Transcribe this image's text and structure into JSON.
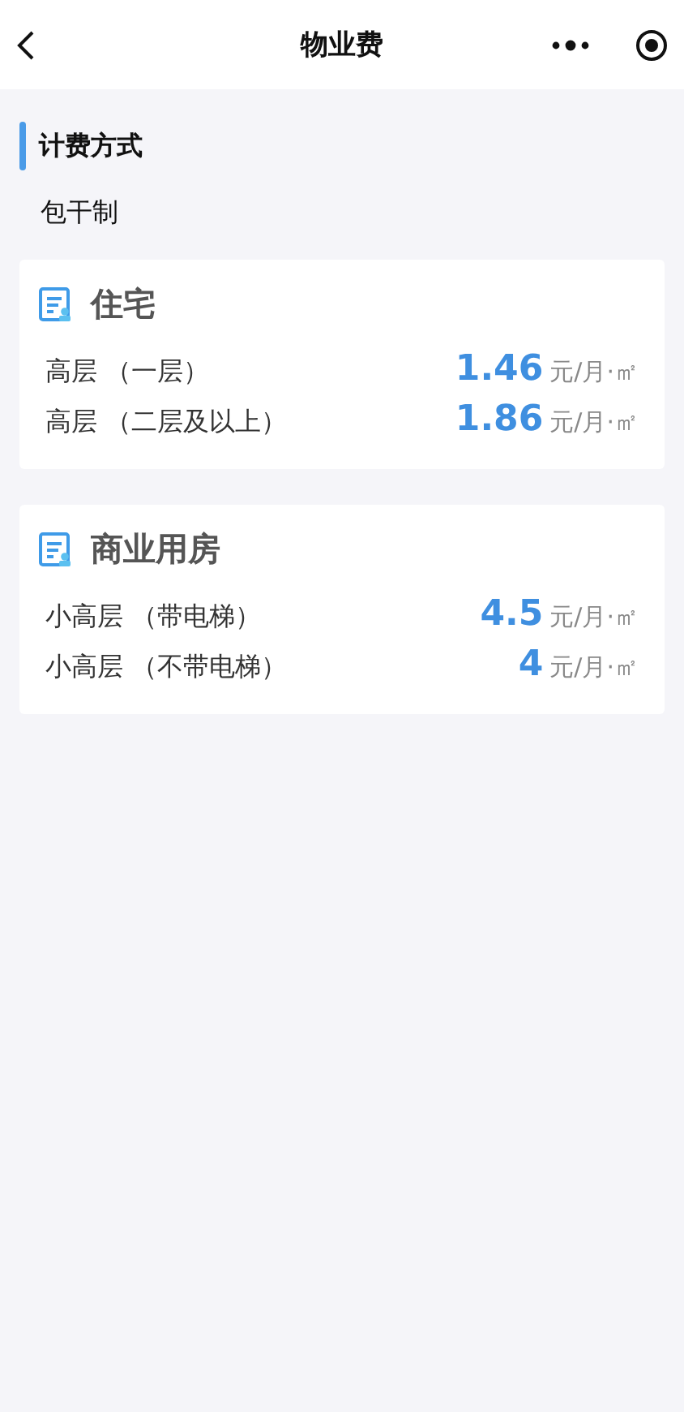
{
  "nav": {
    "title": "物业费"
  },
  "billing": {
    "heading": "计费方式",
    "value": "包干制"
  },
  "sections": [
    {
      "title": "住宅",
      "rows": [
        {
          "label": "高层 （一层）",
          "price": "1.46",
          "unit": "元/月·㎡"
        },
        {
          "label": "高层 （二层及以上）",
          "price": "1.86",
          "unit": "元/月·㎡"
        }
      ]
    },
    {
      "title": "商业用房",
      "rows": [
        {
          "label": "小高层 （带电梯）",
          "price": "4.5",
          "unit": "元/月·㎡"
        },
        {
          "label": "小高层 （不带电梯）",
          "price": "4",
          "unit": "元/月·㎡"
        }
      ]
    }
  ]
}
